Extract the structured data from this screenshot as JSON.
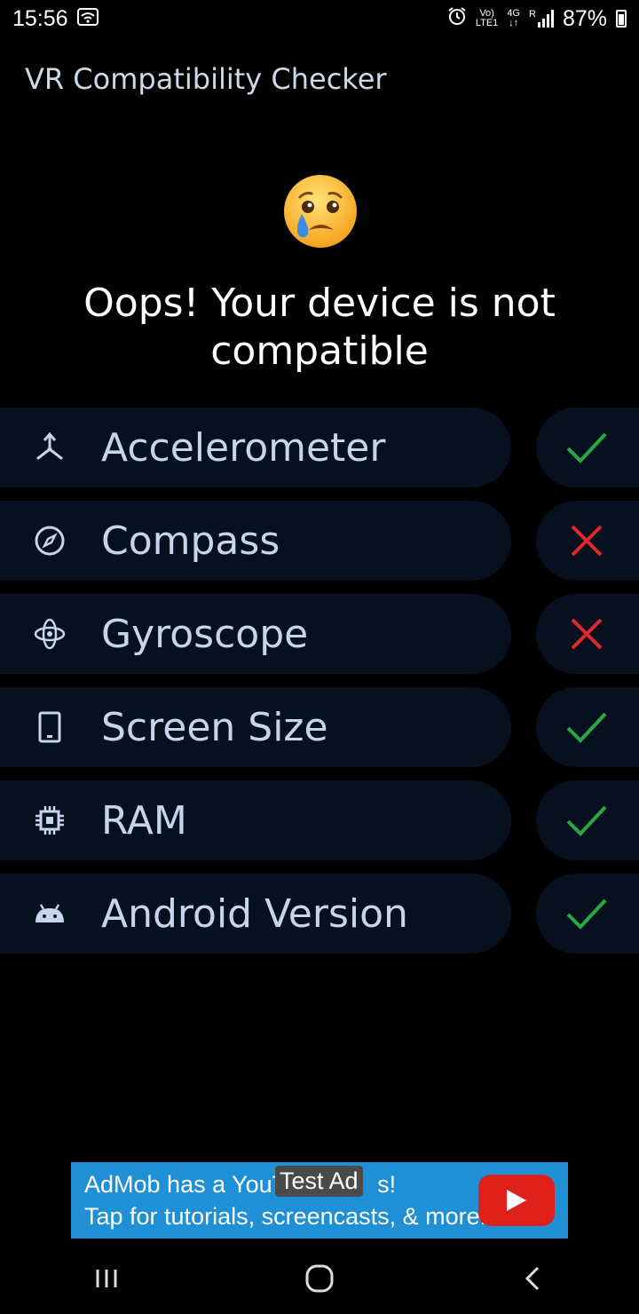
{
  "status_bar": {
    "time": "15:56",
    "volte": "Vo)",
    "lte": "LTE1",
    "network": "4G",
    "roaming": "R",
    "battery": "87%"
  },
  "app": {
    "title": "VR Compatibility Checker"
  },
  "result": {
    "message": "Oops! Your device is not compatible",
    "emoji": "crying-face"
  },
  "checks": [
    {
      "label": "Accelerometer",
      "icon": "accelerometer-icon",
      "status": "pass"
    },
    {
      "label": "Compass",
      "icon": "compass-icon",
      "status": "fail"
    },
    {
      "label": "Gyroscope",
      "icon": "gyroscope-icon",
      "status": "fail"
    },
    {
      "label": "Screen Size",
      "icon": "phone-screen-icon",
      "status": "pass"
    },
    {
      "label": "RAM",
      "icon": "chip-icon",
      "status": "pass"
    },
    {
      "label": "Android Version",
      "icon": "android-icon",
      "status": "pass"
    }
  ],
  "ad": {
    "line1": "AdMob has a YouT",
    "line1_end": "s!",
    "line2": "Tap for tutorials, screencasts, & more.",
    "badge": "Test Ad"
  },
  "colors": {
    "pass": "#27a844",
    "fail": "#e0282a",
    "pill": "#07101f",
    "label": "#c6d5ea",
    "ad_bg": "#1f8fd6"
  }
}
